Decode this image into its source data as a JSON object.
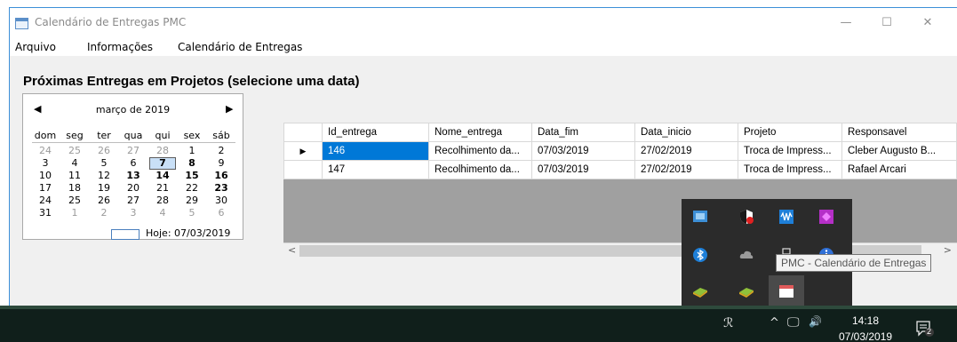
{
  "window": {
    "title": "Calendário de Entregas PMC",
    "controls": {
      "minimize": "—",
      "maximize": "☐",
      "close": "✕"
    }
  },
  "menu": {
    "items": [
      "Arquivo",
      "Informações",
      "Calendário de Entregas"
    ]
  },
  "heading": "Próximas Entregas em Projetos (selecione uma data)",
  "calendar": {
    "prev": "◀",
    "next": "▶",
    "month_label": "março de 2019",
    "weekdays": [
      "dom",
      "seg",
      "ter",
      "qua",
      "qui",
      "sex",
      "sáb"
    ],
    "weeks": [
      [
        "24",
        "25",
        "26",
        "27",
        "28",
        "1",
        "2"
      ],
      [
        "3",
        "4",
        "5",
        "6",
        "7",
        "8",
        "9"
      ],
      [
        "10",
        "11",
        "12",
        "13",
        "14",
        "15",
        "16"
      ],
      [
        "17",
        "18",
        "19",
        "20",
        "21",
        "22",
        "23"
      ],
      [
        "24",
        "25",
        "26",
        "27",
        "28",
        "29",
        "30"
      ],
      [
        "31",
        "1",
        "2",
        "3",
        "4",
        "5",
        "6"
      ]
    ],
    "bold_days": [
      "8",
      "13",
      "14",
      "15",
      "16",
      "23"
    ],
    "selected_day": "7",
    "today_label": "Hoje: 07/03/2019"
  },
  "grid": {
    "columns": [
      "Id_entrega",
      "Nome_entrega",
      "Data_fim",
      "Data_inicio",
      "Projeto",
      "Responsavel"
    ],
    "rows": [
      [
        "146",
        "Recolhimento da...",
        "07/03/2019",
        "27/02/2019",
        "Troca de Impress...",
        "Cleber Augusto B..."
      ],
      [
        "147",
        "Recolhimento da...",
        "07/03/2019",
        "27/02/2019",
        "Troca de Impress...",
        "Rafael Arcari"
      ]
    ],
    "current_row_marker": "▶",
    "scroll_left": "<",
    "scroll_right": ">"
  },
  "tray": {
    "tooltip": "PMC - Calendário de Entregas",
    "icons": [
      "network-status-icon",
      "shield-icon",
      "audio-wave-icon",
      "purple-app-icon",
      "bluetooth-icon",
      "cloud-icon",
      "usb-device-icon",
      "info-icon",
      "green-app-icon",
      "green-app-icon-2",
      "calendar-app-icon"
    ]
  },
  "taskbar": {
    "people": "ℛ",
    "chevron": "^",
    "network": "🖵",
    "volume": "🔊",
    "time": "14:18",
    "date": "07/03/2019",
    "notifications": "2"
  },
  "colors": {
    "selection": "#0078d7",
    "taskbar": "#101f1b",
    "tray_popup": "#2b2b2b"
  }
}
